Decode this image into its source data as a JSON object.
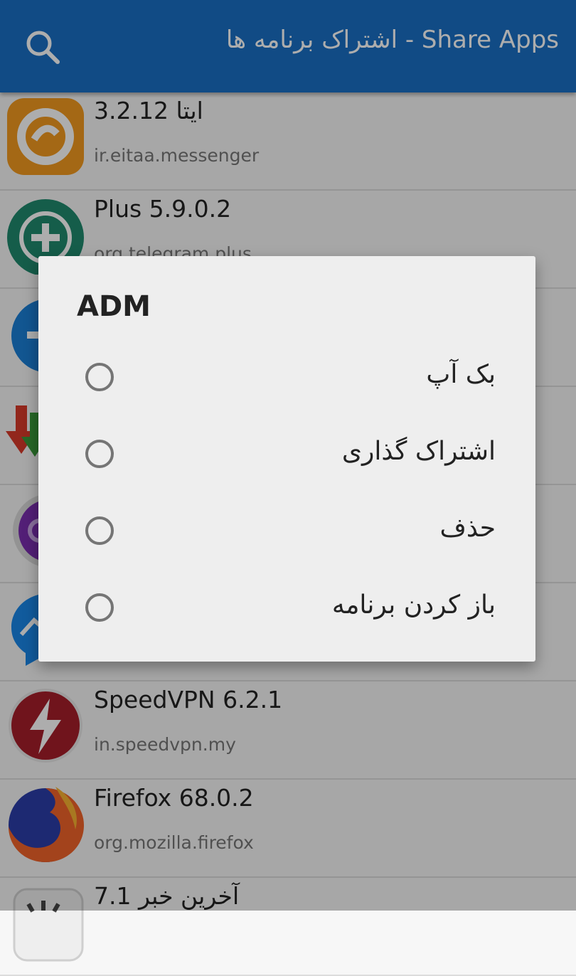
{
  "header": {
    "title": "اشتراک برنامه ها - Share Apps",
    "search_icon": "search-icon",
    "color": "#1a6fc4"
  },
  "apps": [
    {
      "name": "ایتا 3.2.12",
      "package": "ir.eitaa.messenger",
      "icon": "eitaa-app-icon"
    },
    {
      "name": "Plus 5.9.0.2",
      "package": "org.telegram.plus",
      "icon": "plus-messenger-app-icon"
    },
    {
      "name": "",
      "package": "",
      "icon": "blue-app-icon"
    },
    {
      "name": "",
      "package": "",
      "icon": "download-arrows-app-icon"
    },
    {
      "name": "",
      "package": "",
      "icon": "purple-settings-app-icon"
    },
    {
      "name": "",
      "package": "",
      "icon": "messenger-app-icon"
    },
    {
      "name": "SpeedVPN 6.2.1",
      "package": "in.speedvpn.my",
      "icon": "speedvpn-app-icon"
    },
    {
      "name": "Firefox 68.0.2",
      "package": "org.mozilla.firefox",
      "icon": "firefox-app-icon"
    },
    {
      "name": "آخرین خبر 7.1",
      "package": "",
      "icon": "news-app-icon"
    }
  ],
  "dialog": {
    "title": "ADM",
    "options": [
      {
        "label": "بک آپ",
        "selected": false
      },
      {
        "label": "اشتراک گذاری",
        "selected": false
      },
      {
        "label": "حذف",
        "selected": false
      },
      {
        "label": "باز کردن برنامه",
        "selected": false
      }
    ]
  }
}
